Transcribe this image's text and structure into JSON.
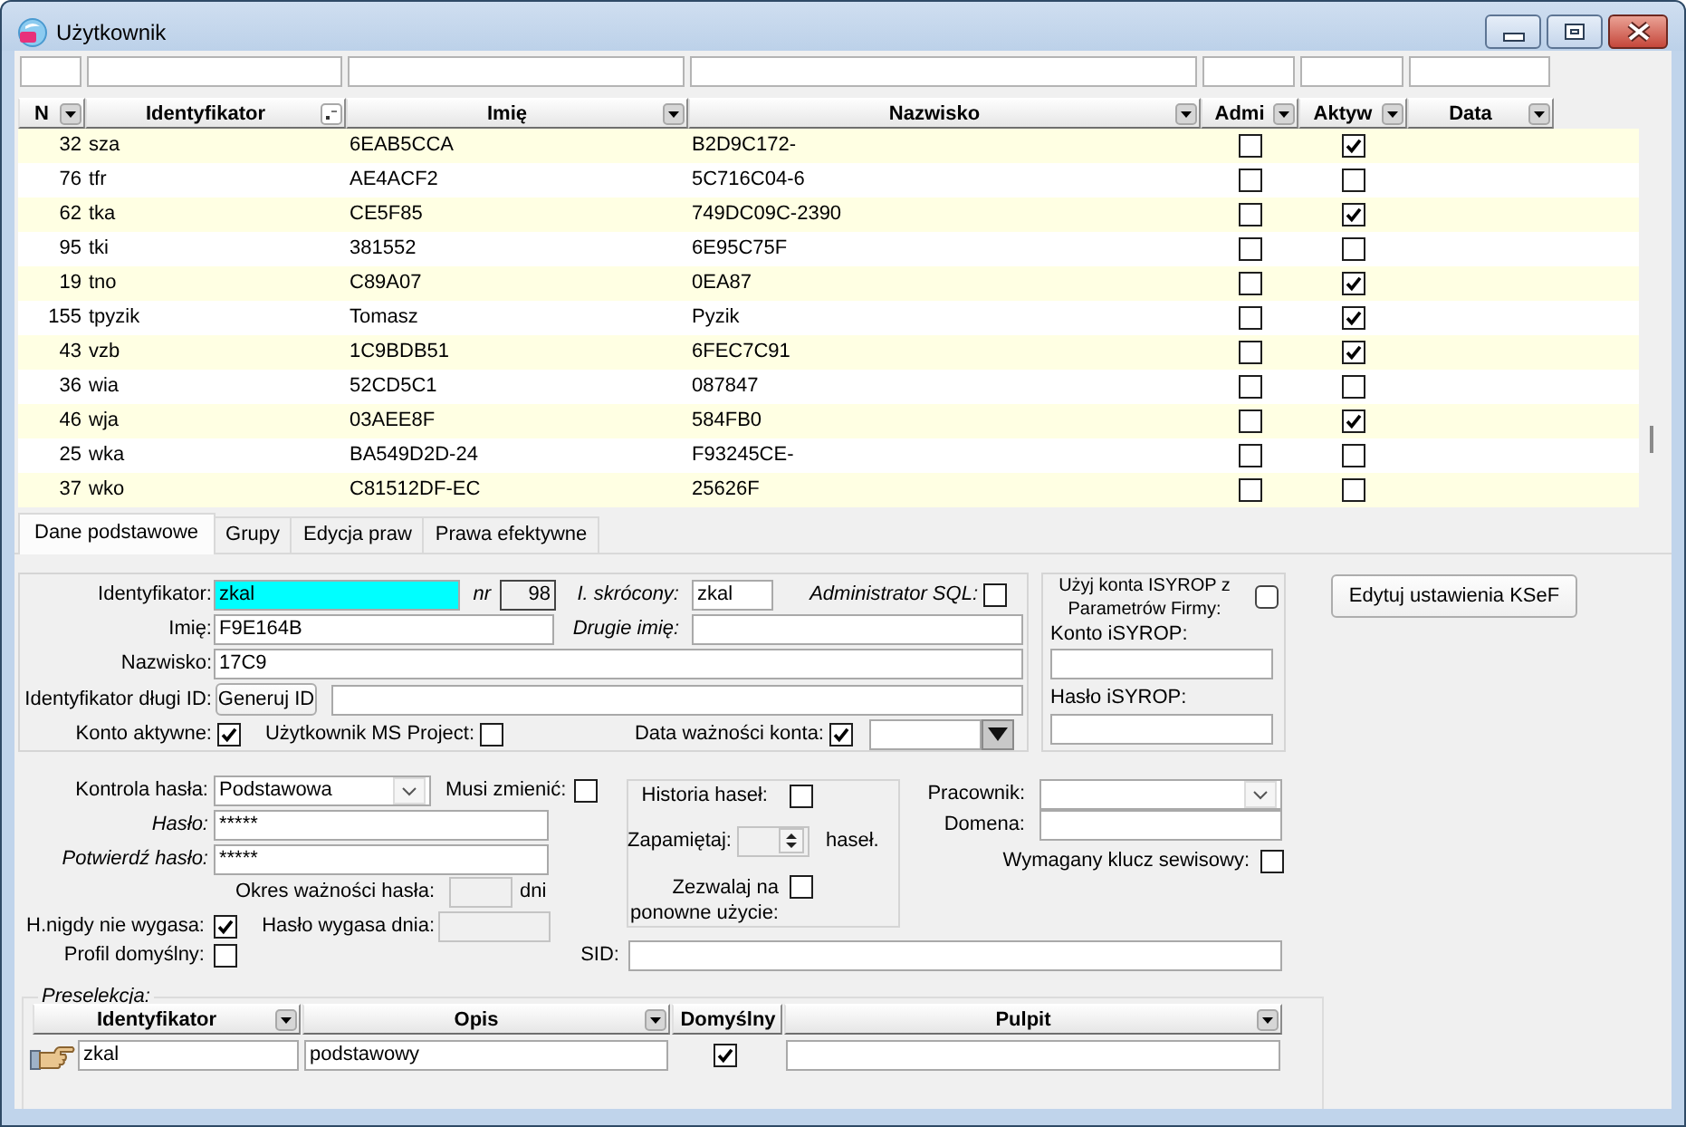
{
  "window": {
    "title": "Użytkownik"
  },
  "table": {
    "columns": [
      {
        "label": "N",
        "kind": "number",
        "sorted": false
      },
      {
        "label": "Identyfikator",
        "kind": "text",
        "sorted": true
      },
      {
        "label": "Imię",
        "kind": "text",
        "sorted": false
      },
      {
        "label": "Nazwisko",
        "kind": "text",
        "sorted": false
      },
      {
        "label": "Admi",
        "kind": "check",
        "sorted": false
      },
      {
        "label": "Aktyw",
        "kind": "check",
        "sorted": false
      },
      {
        "label": "Data",
        "kind": "date",
        "sorted": false
      }
    ],
    "rows": [
      {
        "cells": [
          "32",
          "sza",
          "6EAB5CCA",
          "B2D9C172-"
        ],
        "checks": [
          false,
          true
        ]
      },
      {
        "cells": [
          "76",
          "tfr",
          "AE4ACF2",
          "5C716C04-6"
        ],
        "checks": [
          false,
          false
        ]
      },
      {
        "cells": [
          "62",
          "tka",
          "CE5F85",
          "749DC09C-2390"
        ],
        "checks": [
          false,
          true
        ]
      },
      {
        "cells": [
          "95",
          "tki",
          "381552",
          "6E95C75F"
        ],
        "checks": [
          false,
          false
        ]
      },
      {
        "cells": [
          "19",
          "tno",
          "C89A07",
          "0EA87"
        ],
        "checks": [
          false,
          true
        ]
      },
      {
        "cells": [
          "155",
          "tpyzik",
          "Tomasz",
          "Pyzik"
        ],
        "checks": [
          false,
          true
        ]
      },
      {
        "cells": [
          "43",
          "vzb",
          "1C9BDB51",
          "6FEC7C91"
        ],
        "checks": [
          false,
          true
        ]
      },
      {
        "cells": [
          "36",
          "wia",
          "52CD5C1",
          "087847"
        ],
        "checks": [
          false,
          false
        ]
      },
      {
        "cells": [
          "46",
          "wja",
          "03AEE8F",
          "584FB0"
        ],
        "checks": [
          false,
          true
        ]
      },
      {
        "cells": [
          "25",
          "wka",
          "BA549D2D-24",
          "F93245CE-"
        ],
        "checks": [
          false,
          false
        ]
      },
      {
        "cells": [
          "37",
          "wko",
          "C81512DF-EC",
          "25626F"
        ],
        "checks": [
          false,
          false
        ]
      }
    ]
  },
  "tabs": [
    {
      "label": "Dane podstawowe",
      "selected": true
    },
    {
      "label": "Grupy",
      "selected": false
    },
    {
      "label": "Edycja praw",
      "selected": false
    },
    {
      "label": "Prawa efektywne",
      "selected": false
    }
  ],
  "account": {
    "identifier": {
      "label": "Identyfikator:",
      "value": "zkal"
    },
    "nr": {
      "label": "nr",
      "value": "98"
    },
    "short_name": {
      "label": "I. skrócony:",
      "value": "zkal"
    },
    "sql_admin": {
      "label": "Administrator SQL:",
      "checked": false
    },
    "first_name": {
      "label": "Imię:",
      "value": "F9E164B"
    },
    "second_name": {
      "label": "Drugie imię:"
    },
    "last_name": {
      "label": "Nazwisko:",
      "value": "17C9"
    },
    "long_id": {
      "label": "Identyfikator długi ID:",
      "button": "Generuj ID"
    },
    "active": {
      "label": "Konto aktywne:",
      "checked": true
    },
    "ms_project": {
      "label": "Użytkownik MS Project:",
      "checked": false
    },
    "expiry": {
      "label": "Data ważności konta:",
      "checked": true
    }
  },
  "isyrop": {
    "use_company": {
      "label": "Użyj konta ISYROP z Parametrów Firmy:",
      "checked": false
    },
    "account": {
      "label": "Konto iSYROP:"
    },
    "password": {
      "label": "Hasło iSYROP:"
    }
  },
  "ksef_button": "Edytuj ustawienia KSeF",
  "password": {
    "control": {
      "label": "Kontrola hasła:",
      "value": "Podstawowa"
    },
    "must_change": {
      "label": "Musi zmienić:",
      "checked": false
    },
    "password": {
      "label": "Hasło:",
      "value": "*****"
    },
    "confirm": {
      "label": "Potwierdź hasło:",
      "value": "*****"
    },
    "validity": {
      "label": "Okres ważności hasła:",
      "unit": "dni"
    },
    "never_expires": {
      "label": "H.nigdy nie wygasa:",
      "checked": true
    },
    "expires_on": {
      "label": "Hasło wygasa dnia:"
    },
    "default_profile": {
      "label": "Profil domyślny:",
      "checked": false
    }
  },
  "history": {
    "history": {
      "label": "Historia haseł:",
      "checked": false
    },
    "remember": {
      "label": "Zapamiętaj:",
      "unit": "haseł."
    },
    "reuse": {
      "label": "Zezwalaj na ponowne użycie:",
      "checked": false
    }
  },
  "employee": {
    "label": "Pracownik:"
  },
  "domain": {
    "label": "Domena:"
  },
  "service_key": {
    "label": "Wymagany klucz sewisowy:",
    "checked": false
  },
  "sid": {
    "label": "SID:"
  },
  "preselection": {
    "title": "Preselekcja:",
    "columns": [
      {
        "label": "Identyfikator",
        "filter": true
      },
      {
        "label": "Opis",
        "filter": true
      },
      {
        "label": "Domyślny",
        "filter": false
      },
      {
        "label": "Pulpit",
        "filter": true
      }
    ],
    "rows": [
      {
        "identifier": "zkal",
        "description": "podstawowy",
        "default": true
      }
    ]
  }
}
